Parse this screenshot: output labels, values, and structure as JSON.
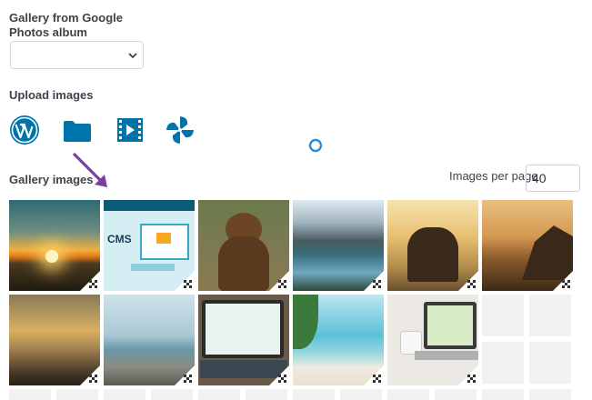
{
  "google_album": {
    "label": "Gallery from Google Photos album",
    "selected": ""
  },
  "upload": {
    "label": "Upload images",
    "sources": [
      {
        "name": "wordpress-icon"
      },
      {
        "name": "folder-icon"
      },
      {
        "name": "video-icon"
      },
      {
        "name": "pinwheel-icon"
      }
    ]
  },
  "gallery": {
    "label": "Gallery images",
    "per_page_label": "Images per page",
    "per_page_value": "40",
    "thumbnails": [
      {
        "name": "sunset-mountains-thumbnail"
      },
      {
        "name": "cms-website-thumbnail"
      },
      {
        "name": "bear-thumbnail"
      },
      {
        "name": "mountain-lake-thumbnail"
      },
      {
        "name": "friends-sunset-thumbnail"
      },
      {
        "name": "coastal-cliff-thumbnail"
      },
      {
        "name": "beach-sunset-thumbnail"
      },
      {
        "name": "rocky-beach-thumbnail"
      },
      {
        "name": "tablet-website-thumbnail"
      },
      {
        "name": "tropical-beach-thumbnail"
      },
      {
        "name": "laptop-coffee-thumbnail"
      }
    ]
  },
  "colors": {
    "accent": "#0073aa",
    "arrow": "#7b3fa0",
    "spinner": "#2e8ddb"
  }
}
